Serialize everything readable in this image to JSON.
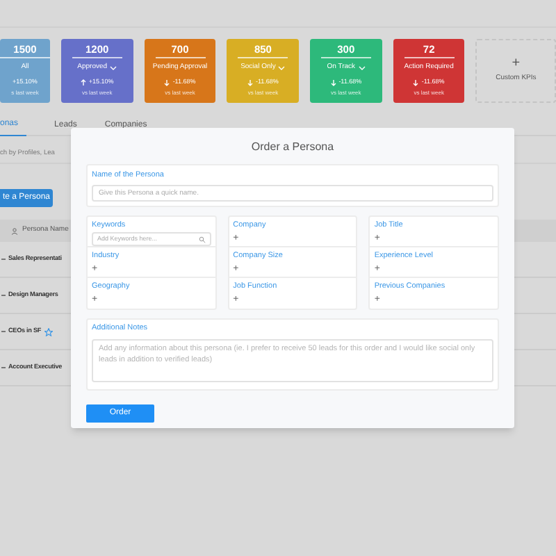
{
  "kpis": [
    {
      "value": "1500",
      "label": "All",
      "dropdown": false,
      "kind": "flat",
      "change": "+15.10%",
      "note": "s last week",
      "color": "#6fa3cc"
    },
    {
      "value": "1200",
      "label": "Approved",
      "dropdown": true,
      "kind": "up",
      "change": "+15.10%",
      "note": "vs last week",
      "color": "#6670c9"
    },
    {
      "value": "700",
      "label": "Pending Approval",
      "dropdown": false,
      "kind": "down",
      "change": "-11.68%",
      "note": "vs last week",
      "color": "#d7761a"
    },
    {
      "value": "850",
      "label": "Social Only",
      "dropdown": true,
      "kind": "down",
      "change": "-11.68%",
      "note": "vs last week",
      "color": "#d8ae24"
    },
    {
      "value": "300",
      "label": "On Track",
      "dropdown": true,
      "kind": "down",
      "change": "-11.68%",
      "note": "vs last week",
      "color": "#2db97b"
    },
    {
      "value": "72",
      "label": "Action Required",
      "dropdown": false,
      "kind": "down",
      "change": "-11.68%",
      "note": "vs last week",
      "color": "#cf3535"
    }
  ],
  "custom_kpis": {
    "icon": "+",
    "label": "Custom KPIs"
  },
  "tabs": [
    {
      "label": "onas",
      "selected": true
    },
    {
      "label": "Leads",
      "selected": false
    },
    {
      "label": "Companies",
      "selected": false
    }
  ],
  "search": {
    "placeholder": "ch by Profiles, Lea"
  },
  "create_button": "te a Persona",
  "table": {
    "column": "Persona Name",
    "rows": [
      {
        "name": "Sales Representati",
        "starred": false
      },
      {
        "name": "Design Managers",
        "starred": false
      },
      {
        "name": "CEOs in SF",
        "starred": true
      },
      {
        "name": "Account Executive",
        "starred": false
      }
    ]
  },
  "modal": {
    "title": "Order a Persona",
    "name_label": "Name of the Persona",
    "name_placeholder": "Give this Persona a quick name.",
    "columns": [
      [
        {
          "label": "Keywords",
          "kind": "search",
          "placeholder": "Add Keywords here..."
        },
        {
          "label": "Industry",
          "kind": "add",
          "icon": "+"
        },
        {
          "label": "Geography",
          "kind": "add",
          "icon": "+"
        }
      ],
      [
        {
          "label": "Company",
          "kind": "add",
          "icon": "+"
        },
        {
          "label": "Company Size",
          "kind": "add",
          "icon": "+"
        },
        {
          "label": "Job Function",
          "kind": "add",
          "icon": "+"
        }
      ],
      [
        {
          "label": "Job Title",
          "kind": "add",
          "icon": "+"
        },
        {
          "label": "Experience Level",
          "kind": "add",
          "icon": "+"
        },
        {
          "label": "Previous Companies",
          "kind": "add",
          "icon": "+"
        }
      ]
    ],
    "notes_label": "Additional Notes",
    "notes_placeholder": "Add any information about this persona (ie. I prefer to receive 50 leads for this order and I would like social only leads in addition to verified leads)",
    "order_button": "Order"
  }
}
